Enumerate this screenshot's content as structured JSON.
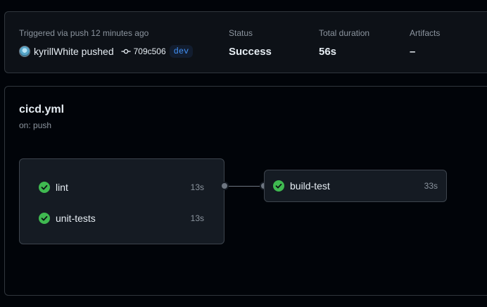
{
  "summary": {
    "trigger_label": "Triggered via push 12 minutes ago",
    "actor": "kyrillWhite pushed",
    "commit_sha": "709c506",
    "branch": "dev",
    "status_label": "Status",
    "status_value": "Success",
    "duration_label": "Total duration",
    "duration_value": "56s",
    "artifacts_label": "Artifacts",
    "artifacts_value": "–"
  },
  "workflow": {
    "name": "cicd.yml",
    "trigger": "on: push",
    "jobs": [
      {
        "name": "lint",
        "duration": "13s",
        "status": "success"
      },
      {
        "name": "unit-tests",
        "duration": "13s",
        "status": "success"
      },
      {
        "name": "build-test",
        "duration": "33s",
        "status": "success"
      }
    ]
  },
  "colors": {
    "success": "#3fb950",
    "link": "#4493f8",
    "border": "#30363d",
    "muted": "#8b949e"
  },
  "icons": [
    "avatar",
    "commit-icon",
    "check-circle-icon"
  ]
}
